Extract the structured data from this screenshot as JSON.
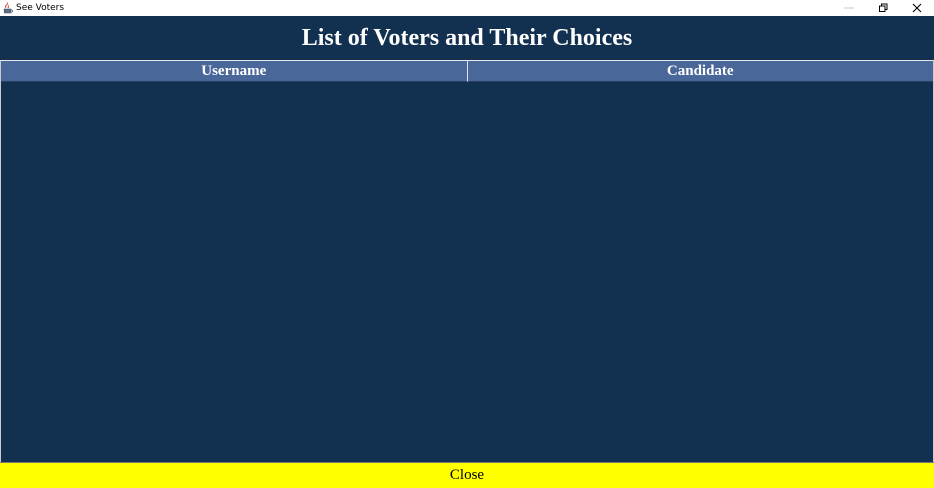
{
  "window": {
    "title": "See Voters",
    "app_icon": "java-cup-icon",
    "controls": {
      "minimize_icon": "minimize-icon",
      "restore_icon": "restore-icon",
      "close_icon": "close-icon"
    }
  },
  "main": {
    "heading": "List of Voters and Their Choices",
    "table": {
      "columns": [
        "Username",
        "Candidate"
      ],
      "rows": []
    },
    "close_button_label": "Close"
  },
  "colors": {
    "background": "#12304f",
    "table_header": "#4a679a",
    "close_button": "#ffff00",
    "heading_text": "#ffffff"
  }
}
